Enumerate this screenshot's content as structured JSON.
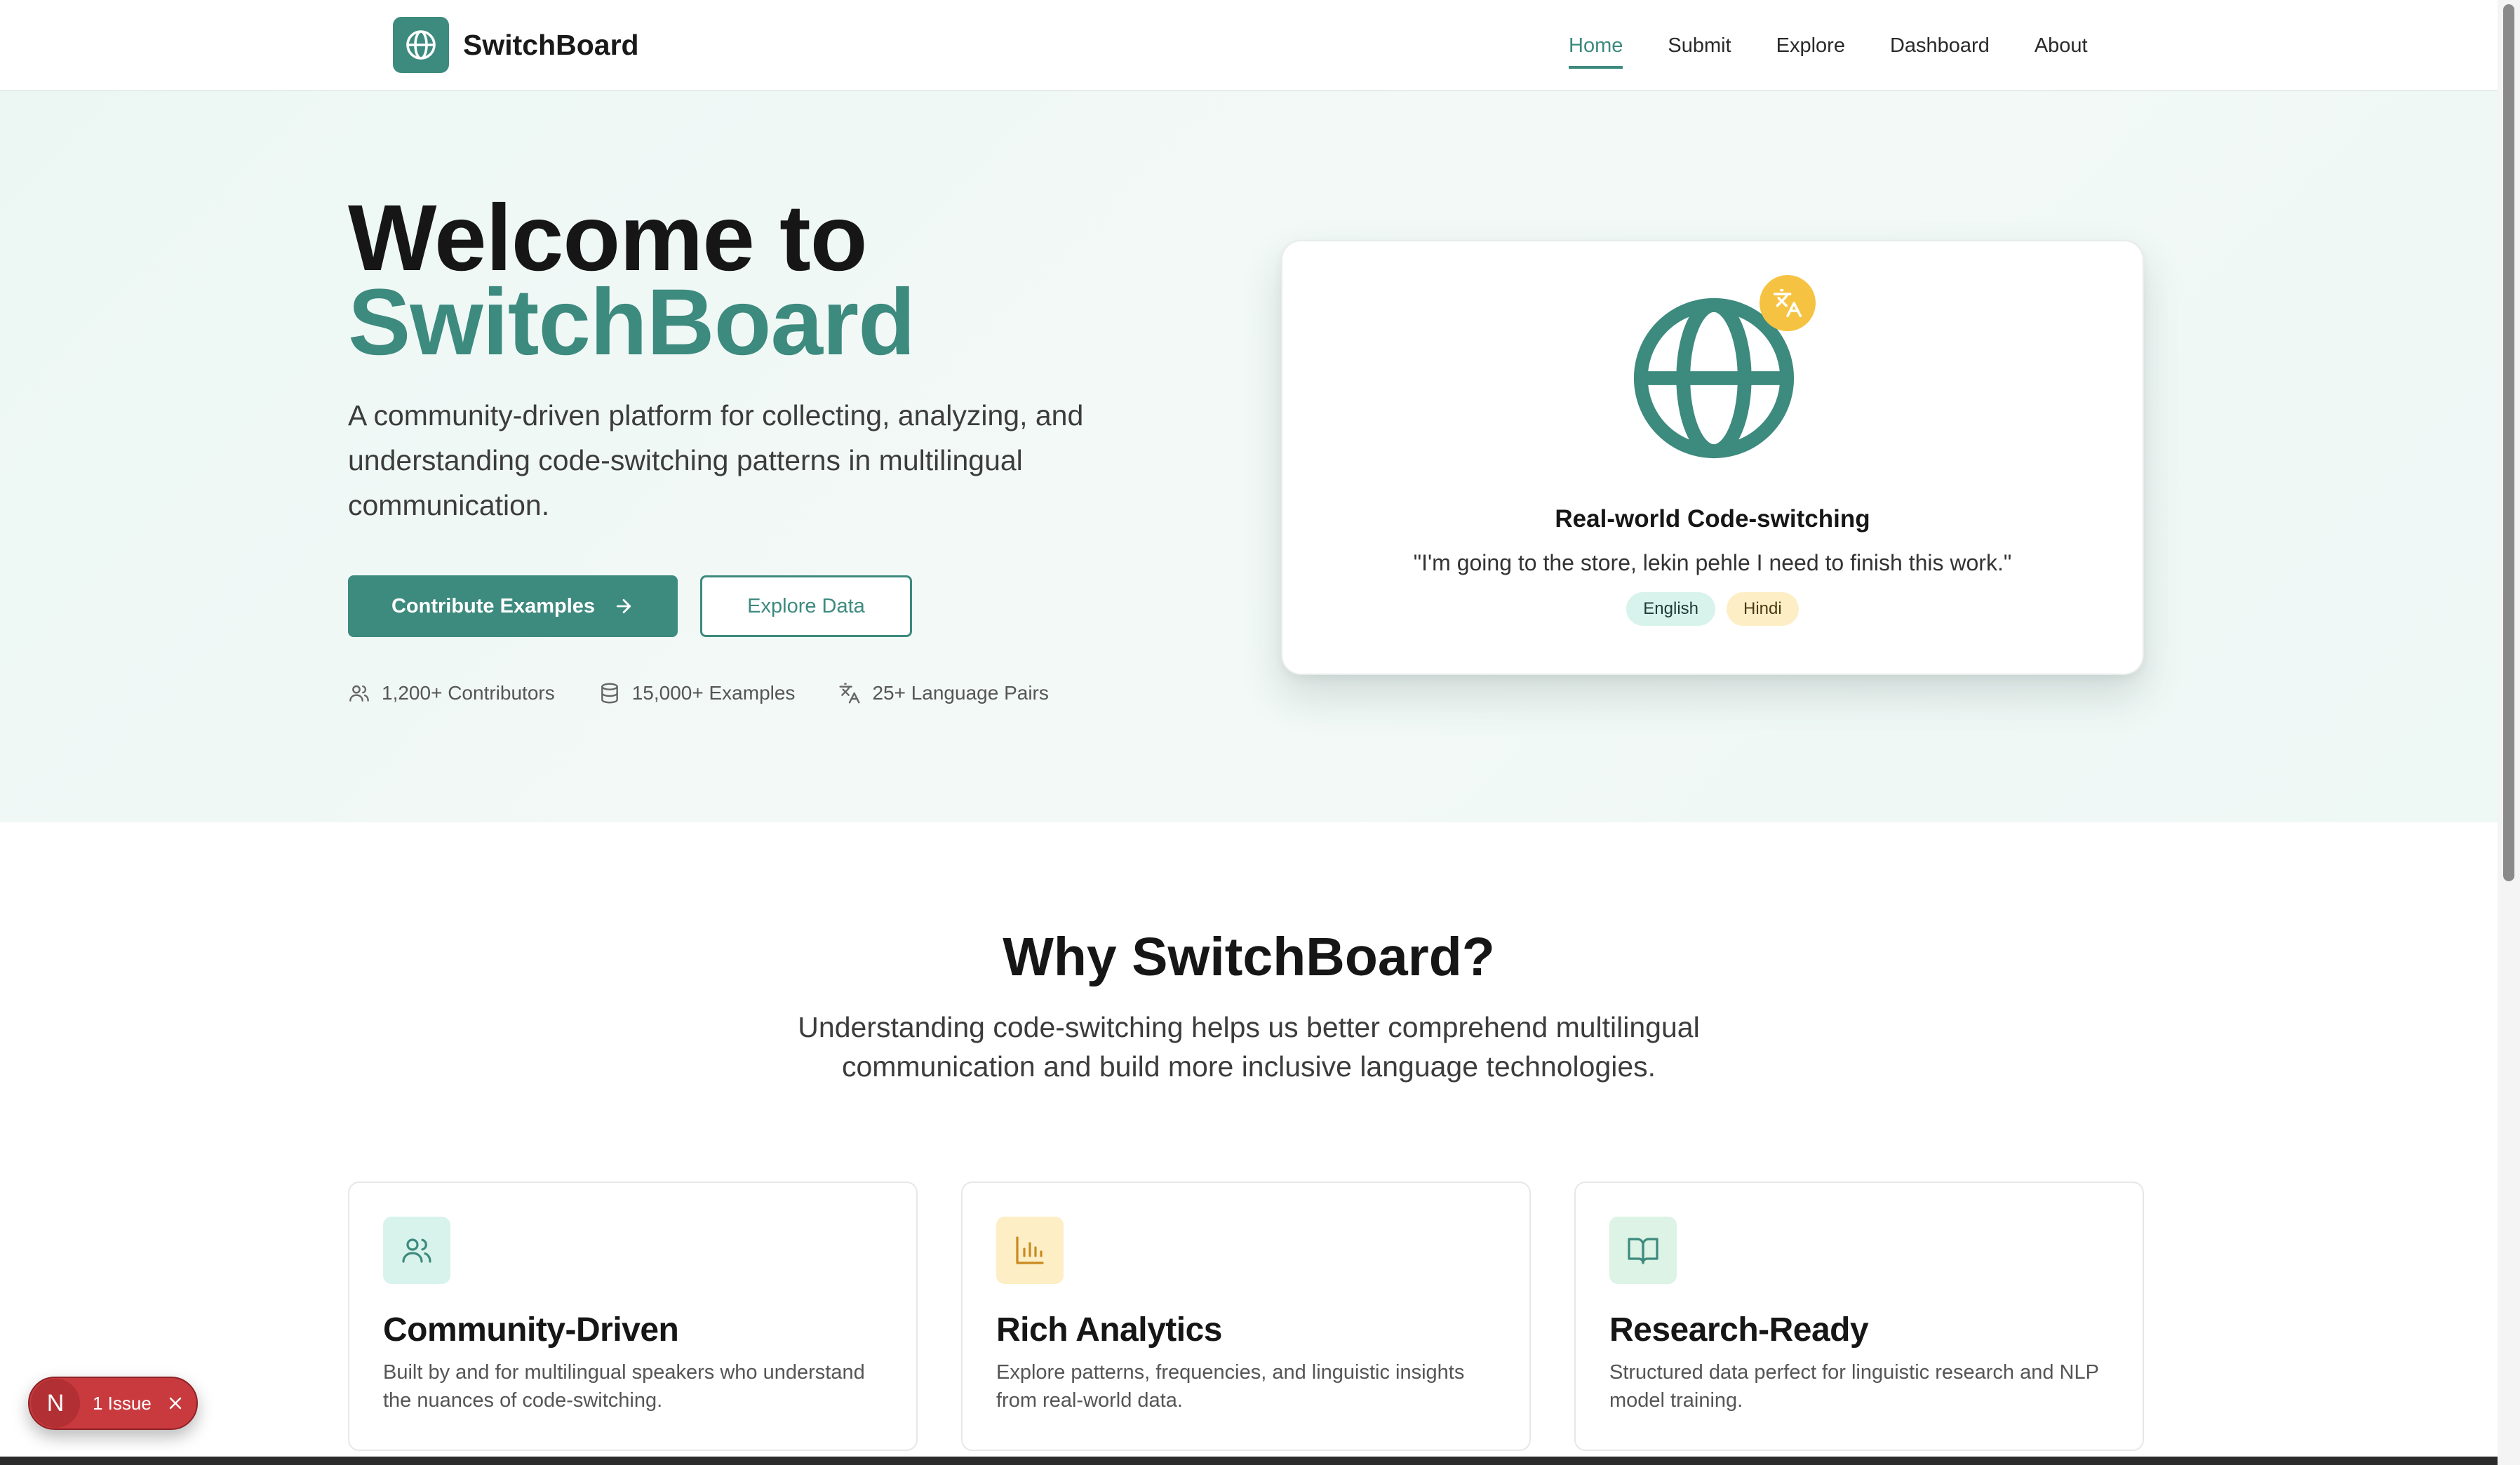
{
  "nav": {
    "brand": "SwitchBoard",
    "links": [
      "Home",
      "Submit",
      "Explore",
      "Dashboard",
      "About"
    ],
    "active": "Home"
  },
  "hero": {
    "title_line1": "Welcome to",
    "title_line2": "SwitchBoard",
    "description": "A community-driven platform for collecting, analyzing, and understanding code-switching patterns in multilingual communication.",
    "primary_button": "Contribute Examples",
    "secondary_button": "Explore Data",
    "stats": [
      {
        "icon": "users-icon",
        "label": "1,200+ Contributors"
      },
      {
        "icon": "database-icon",
        "label": "15,000+ Examples"
      },
      {
        "icon": "translate-icon",
        "label": "25+ Language Pairs"
      }
    ]
  },
  "example_card": {
    "title": "Real-world Code-switching",
    "quote": "\"I'm going to the store, lekin pehle I need to finish this work.\"",
    "tags": [
      "English",
      "Hindi"
    ]
  },
  "why": {
    "title": "Why SwitchBoard?",
    "subtitle": "Understanding code-switching helps us better comprehend multilingual communication and build more inclusive language technologies.",
    "features": [
      {
        "icon": "users-icon",
        "title": "Community-Driven",
        "description": "Built by and for multilingual speakers who understand the nuances of code-switching."
      },
      {
        "icon": "bar-chart-icon",
        "title": "Rich Analytics",
        "description": "Explore patterns, frequencies, and linguistic insights from real-world data."
      },
      {
        "icon": "book-open-icon",
        "title": "Research-Ready",
        "description": "Structured data perfect for linguistic research and NLP model training."
      }
    ]
  },
  "issue_badge": {
    "letter": "N",
    "text": "1 Issue"
  },
  "colors": {
    "accent": "#3d8a7e",
    "badge_yellow": "#f5c341",
    "issue_red": "#c93a3f"
  }
}
